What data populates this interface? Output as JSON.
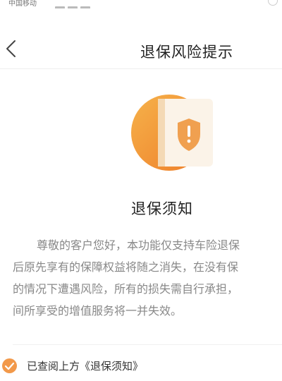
{
  "status_bar": {
    "carrier": "中国移动"
  },
  "nav": {
    "title": "退保风险提示",
    "back_icon": "chevron-left-icon"
  },
  "hero": {
    "icon": "shield-warning-icon",
    "accent": "#f39a2b"
  },
  "notice": {
    "title": "退保须知",
    "lines": [
      "尊敬的客户您好，本功能仅支持车险退保",
      "后原先享有的保障权益将随之消失，在没有保",
      "的情况下遭遇风险，所有的损失需自行承担，",
      "间所享受的增值服务将一并失效。"
    ]
  },
  "agreement": {
    "checked": true,
    "label": "已查阅上方《退保须知》"
  },
  "colors": {
    "accent": "#f2994a",
    "text": "#333333",
    "muted": "#888888"
  }
}
